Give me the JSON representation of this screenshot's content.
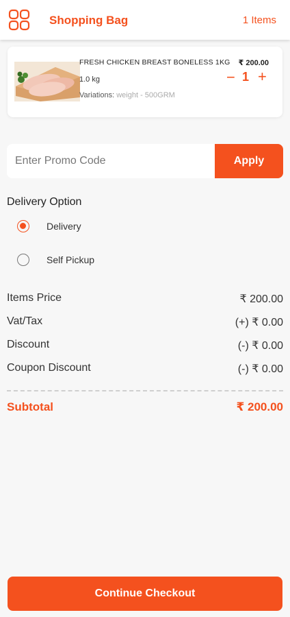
{
  "header": {
    "title": "Shopping Bag",
    "item_count": "1 Items",
    "menu_icon": "grid-menu-icon",
    "accent_color": "#f4511e"
  },
  "cart": {
    "items": [
      {
        "name": "FRESH CHICKEN BREAST BONELESS 1KG",
        "price": "₹ 200.00",
        "weight": "1.0 kg",
        "variation_label": "Variations:",
        "variation_value": "weight - 500GRM",
        "quantity": "1",
        "minus_symbol": "−",
        "plus_symbol": "+"
      }
    ]
  },
  "promo": {
    "placeholder": "Enter Promo Code",
    "apply_label": "Apply"
  },
  "delivery": {
    "title": "Delivery Option",
    "options": [
      {
        "label": "Delivery",
        "selected": true
      },
      {
        "label": "Self Pickup",
        "selected": false
      }
    ]
  },
  "summary": {
    "rows": [
      {
        "label": "Items Price",
        "value": "₹ 200.00"
      },
      {
        "label": "Vat/Tax",
        "value": "(+) ₹ 0.00"
      },
      {
        "label": "Discount",
        "value": "(-) ₹ 0.00"
      },
      {
        "label": "Coupon Discount",
        "value": "(-) ₹ 0.00"
      }
    ],
    "subtotal_label": "Subtotal",
    "subtotal_value": "₹ 200.00"
  },
  "checkout": {
    "label": "Continue Checkout"
  }
}
